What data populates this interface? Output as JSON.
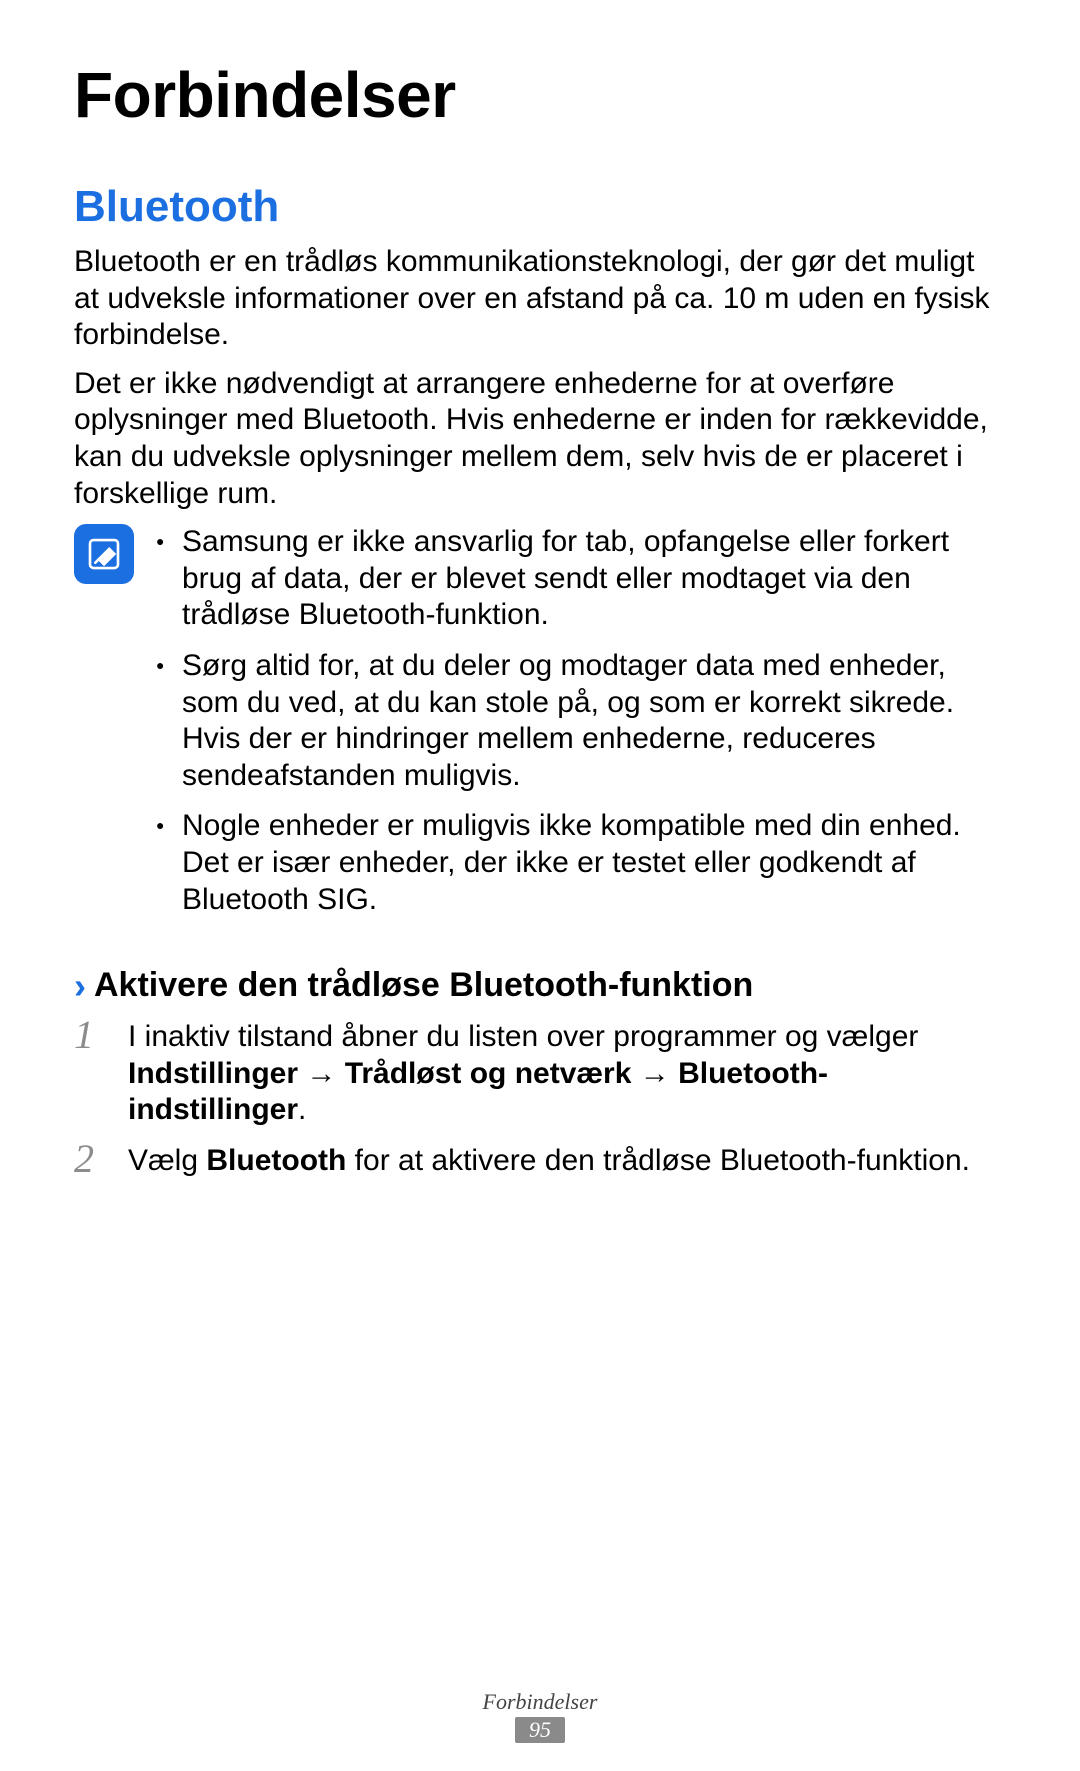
{
  "chapter_title": "Forbindelser",
  "section_title": "Bluetooth",
  "paragraphs": {
    "p1": "Bluetooth er en trådløs kommunikationsteknologi, der gør det muligt at udveksle informationer over en afstand på ca. 10 m uden en fysisk forbindelse.",
    "p2": "Det er ikke nødvendigt at arrangere enhederne for at overføre oplysninger med Bluetooth. Hvis enhederne er inden for rækkevidde, kan du udveksle oplysninger mellem dem, selv hvis de er placeret i forskellige rum."
  },
  "notes": [
    "Samsung er ikke ansvarlig for tab, opfangelse eller forkert brug af data, der er blevet sendt eller modtaget via den trådløse Bluetooth-funktion.",
    "Sørg altid for, at du deler og modtager data med enheder, som du ved, at du kan stole på, og som er korrekt sikrede. Hvis der er hindringer mellem enhederne, reduceres sendeafstanden muligvis.",
    "Nogle enheder er muligvis ikke kompatible med din enhed. Det er især enheder, der ikke er testet eller godkendt af Bluetooth SIG."
  ],
  "subsection_title": "Aktivere den trådløse Bluetooth-funktion",
  "steps": [
    {
      "number": "1",
      "pre": "I inaktiv tilstand åbner du listen over programmer og vælger ",
      "bold1": "Indstillinger",
      "arrow1": " → ",
      "bold2": "Trådløst og netværk",
      "arrow2": " → ",
      "bold3": "Bluetooth-indstillinger",
      "post": "."
    },
    {
      "number": "2",
      "pre": "Vælg ",
      "bold1": "Bluetooth",
      "post": " for at aktivere den trådløse Bluetooth-funktion."
    }
  ],
  "footer": {
    "section": "Forbindelser",
    "page": "95"
  }
}
